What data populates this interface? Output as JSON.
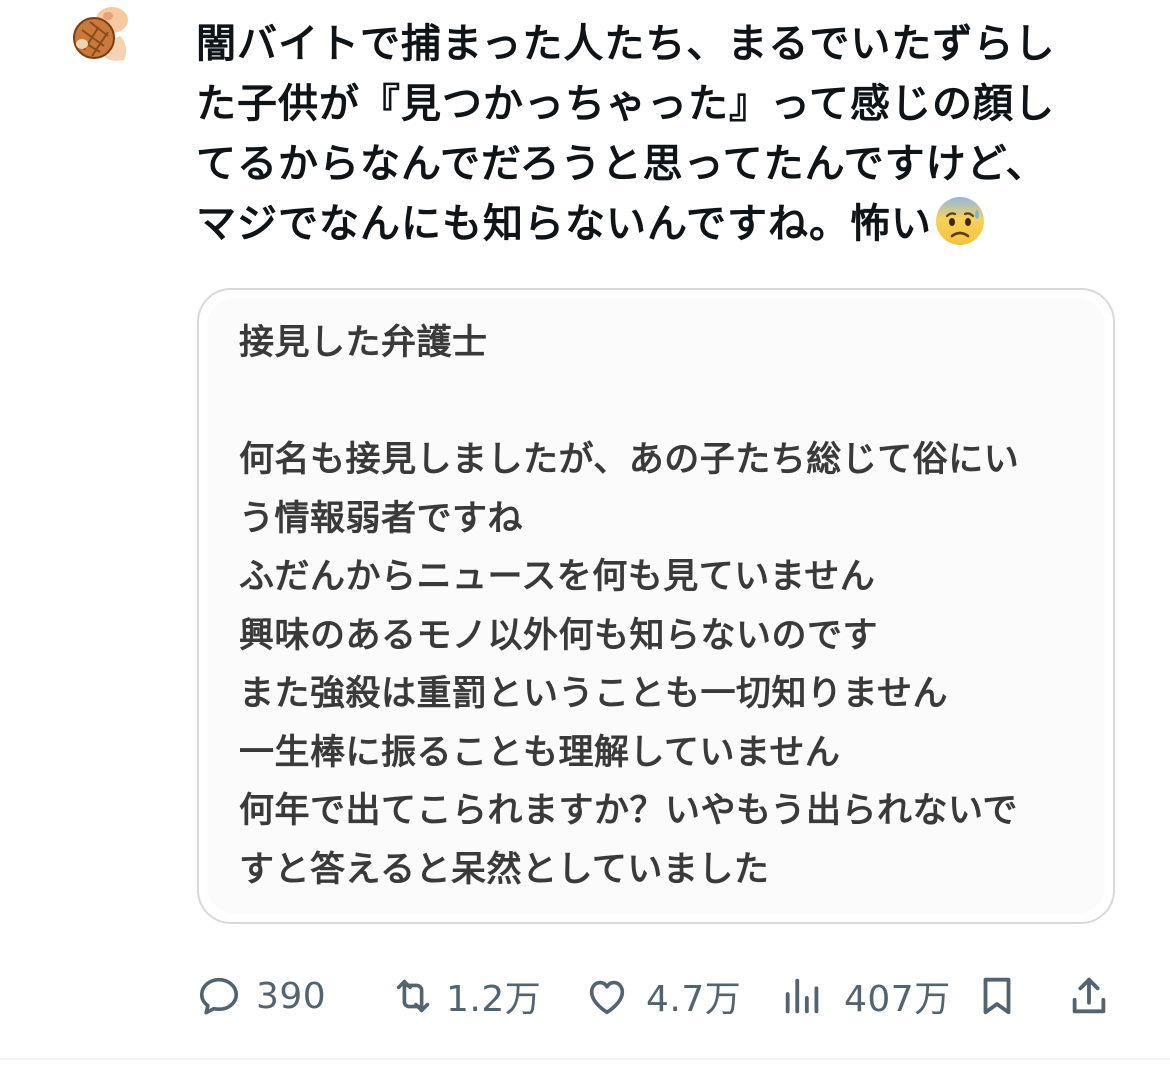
{
  "tweet": {
    "text": "闇バイトで捕まった人たち、まるでいたずらした子供が『見つかっちゃった』って感じの顔してるからなんでだろうと思ってたんですけど、マジでなんにも知らないんですね。怖い",
    "line1": "闇バイトで捕まった人たち、まるでいたずらし",
    "line2": "た子供が『見つかっちゃった』って感じの顔し",
    "line3": "てるからなんでだろうと思ってたんですけど、",
    "line4": "マジでなんにも知らないんですね。怖い",
    "emoji": "anxious-face-with-sweat-icon"
  },
  "quote": {
    "title": "接見した弁護士",
    "lines": [
      "何名も接見しましたが、あの子たち総じて俗にい",
      "う情報弱者ですね",
      "ふだんからニュースを何も見ていません",
      "興味のあるモノ以外何も知らないのです",
      "また強殺は重罰ということも一切知りません",
      "一生棒に振ることも理解していません",
      "何年で出てこられますか？いやもう出られないで",
      "すと答えると呆然としていました"
    ]
  },
  "actions": {
    "replies": "390",
    "retweets": "1.2万",
    "likes": "4.7万",
    "views": "407万"
  },
  "icons": {
    "reply": "reply-icon",
    "retweet": "retweet-icon",
    "like": "heart-icon",
    "views": "views-icon",
    "bookmark": "bookmark-icon",
    "share": "share-icon"
  },
  "colors": {
    "action_gray": "#536471",
    "card_border": "#d6dadf",
    "text": "#0f1419"
  }
}
